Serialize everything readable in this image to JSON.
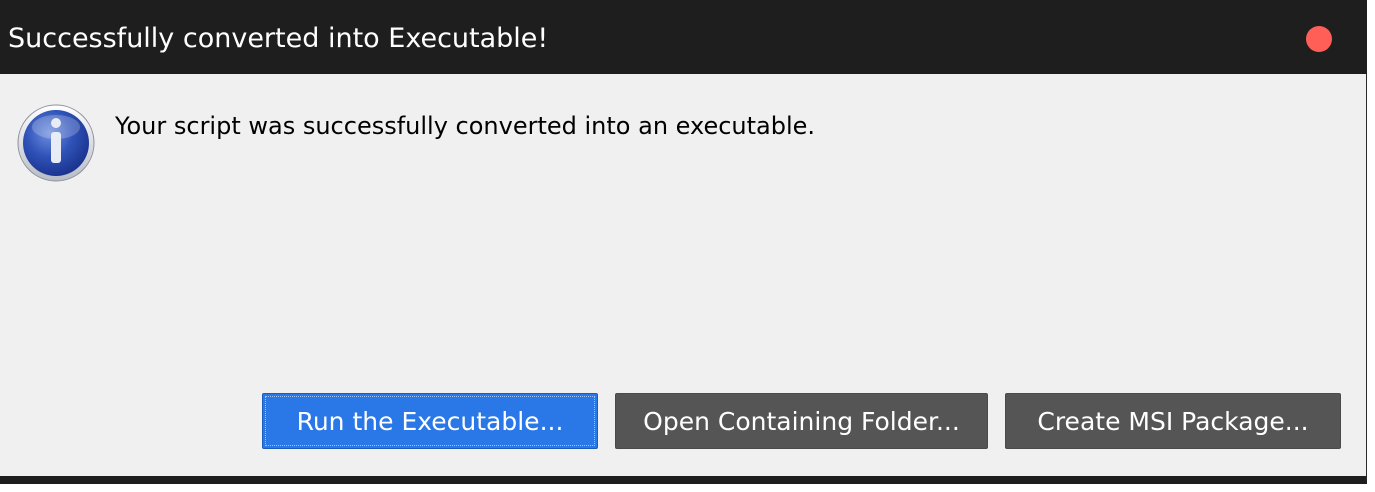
{
  "window": {
    "title": "Successfully converted into Executable!",
    "close_color": "#ff5f57"
  },
  "dialog": {
    "icon": "info-icon",
    "message": "Your script was successfully converted into an executable."
  },
  "buttons": {
    "run": "Run the Executable...",
    "open_folder": "Open Containing Folder...",
    "create_msi": "Create MSI Package..."
  },
  "colors": {
    "titlebar": "#1e1e1e",
    "background": "#f0f0f0",
    "primary_button": "#2a78e8",
    "secondary_button": "#555555"
  }
}
